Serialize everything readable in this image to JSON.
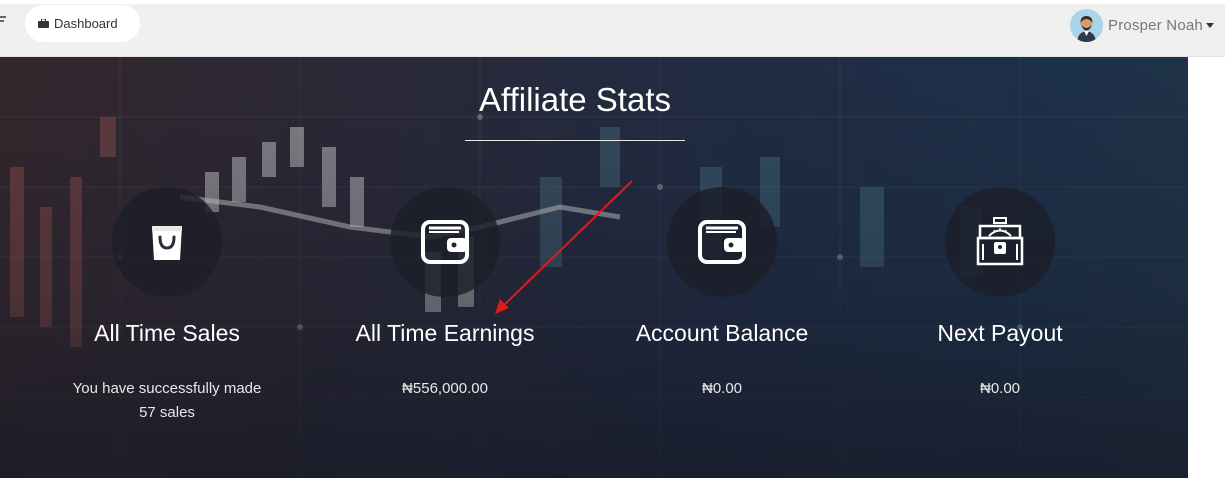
{
  "topbar": {
    "menu_icon": "hamburger-icon",
    "dashboard_label": "Dashboard",
    "dashboard_icon": "briefcase-icon",
    "user_name": "Prosper Noah",
    "avatar_icon": "user-avatar"
  },
  "hero": {
    "title": "Affiliate Stats",
    "stats": [
      {
        "icon": "shopping-bag-icon",
        "label": "All Time Sales",
        "value_line1": "You have successfully made",
        "value_line2": "57 sales"
      },
      {
        "icon": "wallet-icon",
        "label": "All Time Earnings",
        "value_line1": "₦556,000.00",
        "value_line2": ""
      },
      {
        "icon": "wallet-icon",
        "label": "Account Balance",
        "value_line1": "₦0.00",
        "value_line2": ""
      },
      {
        "icon": "treasure-chest-icon",
        "label": "Next Payout",
        "value_line1": "₦0.00",
        "value_line2": ""
      }
    ]
  },
  "colors": {
    "annotation_arrow": "#e01919",
    "hero_text": "#ffffff"
  }
}
